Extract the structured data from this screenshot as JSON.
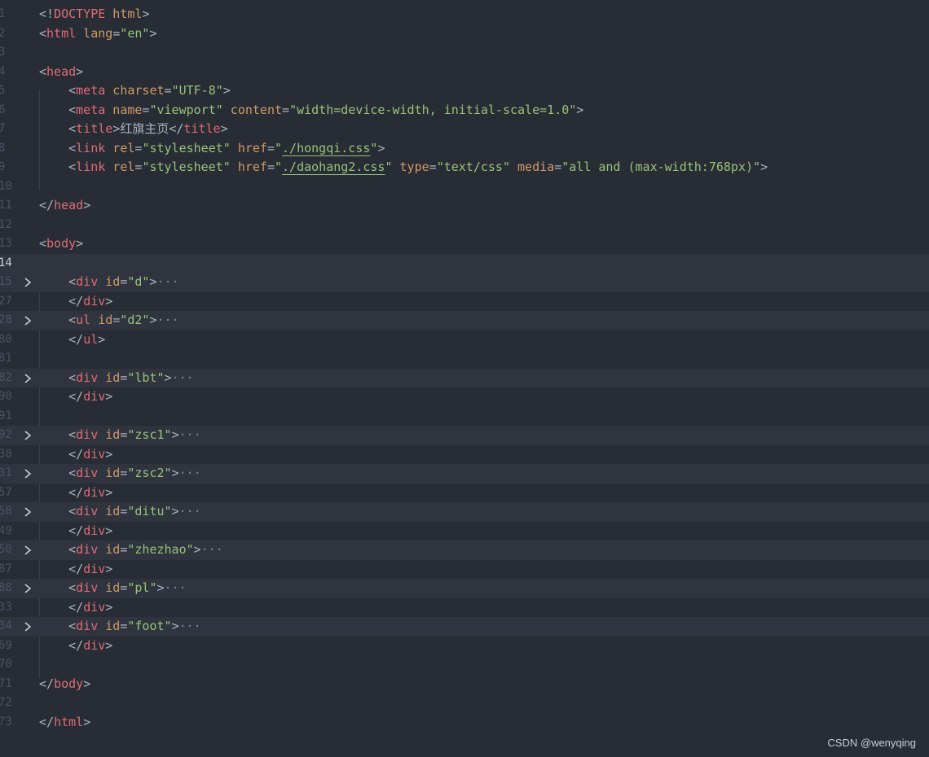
{
  "editor": {
    "lines": [
      {
        "num": "1",
        "tokens": [
          {
            "t": "<!",
            "c": "punc"
          },
          {
            "t": "DOCTYPE",
            "c": "tag"
          },
          {
            "t": " html",
            "c": "attr"
          },
          {
            "t": ">",
            "c": "punc"
          }
        ]
      },
      {
        "num": "2",
        "tokens": [
          {
            "t": "<",
            "c": "punc"
          },
          {
            "t": "html",
            "c": "tag"
          },
          {
            "t": " lang",
            "c": "attr"
          },
          {
            "t": "=",
            "c": "punc"
          },
          {
            "t": "\"en\"",
            "c": "str"
          },
          {
            "t": ">",
            "c": "punc"
          }
        ]
      },
      {
        "num": "3",
        "tokens": []
      },
      {
        "num": "4",
        "tokens": [
          {
            "t": "<",
            "c": "punc"
          },
          {
            "t": "head",
            "c": "tag"
          },
          {
            "t": ">",
            "c": "punc"
          }
        ]
      },
      {
        "num": "5",
        "tokens": [
          {
            "t": "    <",
            "c": "punc"
          },
          {
            "t": "meta",
            "c": "tag"
          },
          {
            "t": " charset",
            "c": "attr"
          },
          {
            "t": "=",
            "c": "punc"
          },
          {
            "t": "\"UTF-8\"",
            "c": "str"
          },
          {
            "t": ">",
            "c": "punc"
          }
        ]
      },
      {
        "num": "6",
        "tokens": [
          {
            "t": "    <",
            "c": "punc"
          },
          {
            "t": "meta",
            "c": "tag"
          },
          {
            "t": " name",
            "c": "attr"
          },
          {
            "t": "=",
            "c": "punc"
          },
          {
            "t": "\"viewport\"",
            "c": "str"
          },
          {
            "t": " content",
            "c": "attr"
          },
          {
            "t": "=",
            "c": "punc"
          },
          {
            "t": "\"width=device-width, initial-scale=1.0\"",
            "c": "str"
          },
          {
            "t": ">",
            "c": "punc"
          }
        ]
      },
      {
        "num": "7",
        "tokens": [
          {
            "t": "    <",
            "c": "punc"
          },
          {
            "t": "title",
            "c": "tag"
          },
          {
            "t": ">",
            "c": "punc"
          },
          {
            "t": "红旗主页",
            "c": "text"
          },
          {
            "t": "</",
            "c": "punc"
          },
          {
            "t": "title",
            "c": "tag"
          },
          {
            "t": ">",
            "c": "punc"
          }
        ]
      },
      {
        "num": "8",
        "tokens": [
          {
            "t": "    <",
            "c": "punc"
          },
          {
            "t": "link",
            "c": "tag"
          },
          {
            "t": " rel",
            "c": "attr"
          },
          {
            "t": "=",
            "c": "punc"
          },
          {
            "t": "\"stylesheet\"",
            "c": "str"
          },
          {
            "t": " href",
            "c": "attr"
          },
          {
            "t": "=",
            "c": "punc"
          },
          {
            "t": "\"",
            "c": "str"
          },
          {
            "t": "./hongqi.css",
            "c": "link"
          },
          {
            "t": "\"",
            "c": "str"
          },
          {
            "t": ">",
            "c": "punc"
          }
        ]
      },
      {
        "num": "9",
        "tokens": [
          {
            "t": "    <",
            "c": "punc"
          },
          {
            "t": "link",
            "c": "tag"
          },
          {
            "t": " rel",
            "c": "attr"
          },
          {
            "t": "=",
            "c": "punc"
          },
          {
            "t": "\"stylesheet\"",
            "c": "str"
          },
          {
            "t": " href",
            "c": "attr"
          },
          {
            "t": "=",
            "c": "punc"
          },
          {
            "t": "\"",
            "c": "str"
          },
          {
            "t": "./daohang2.css",
            "c": "link"
          },
          {
            "t": "\"",
            "c": "str"
          },
          {
            "t": " type",
            "c": "attr"
          },
          {
            "t": "=",
            "c": "punc"
          },
          {
            "t": "\"text/css\"",
            "c": "str"
          },
          {
            "t": " media",
            "c": "attr"
          },
          {
            "t": "=",
            "c": "punc"
          },
          {
            "t": "\"all and (max-width:768px)\"",
            "c": "str"
          },
          {
            "t": ">",
            "c": "punc"
          }
        ]
      },
      {
        "num": "10",
        "tokens": []
      },
      {
        "num": "11",
        "tokens": [
          {
            "t": "</",
            "c": "punc"
          },
          {
            "t": "head",
            "c": "tag"
          },
          {
            "t": ">",
            "c": "punc"
          }
        ]
      },
      {
        "num": "12",
        "tokens": []
      },
      {
        "num": "13",
        "tokens": [
          {
            "t": "<",
            "c": "punc"
          },
          {
            "t": "body",
            "c": "tag"
          },
          {
            "t": ">",
            "c": "punc"
          }
        ]
      },
      {
        "num": "14",
        "active": true,
        "highlight": true,
        "tokens": []
      },
      {
        "num": "15",
        "fold": true,
        "highlight": true,
        "tokens": [
          {
            "t": "    <",
            "c": "punc"
          },
          {
            "t": "div",
            "c": "tag"
          },
          {
            "t": " id",
            "c": "attr"
          },
          {
            "t": "=",
            "c": "punc"
          },
          {
            "t": "\"d\"",
            "c": "str"
          },
          {
            "t": ">",
            "c": "punc"
          },
          {
            "t": "···",
            "c": "dots"
          }
        ]
      },
      {
        "num": "27",
        "tokens": [
          {
            "t": "    </",
            "c": "punc"
          },
          {
            "t": "div",
            "c": "tag"
          },
          {
            "t": ">",
            "c": "punc"
          }
        ]
      },
      {
        "num": "28",
        "fold": true,
        "highlight": true,
        "tokens": [
          {
            "t": "    <",
            "c": "punc"
          },
          {
            "t": "ul",
            "c": "tag"
          },
          {
            "t": " id",
            "c": "attr"
          },
          {
            "t": "=",
            "c": "punc"
          },
          {
            "t": "\"d2\"",
            "c": "str"
          },
          {
            "t": ">",
            "c": "punc"
          },
          {
            "t": "···",
            "c": "dots"
          }
        ]
      },
      {
        "num": "80",
        "tokens": [
          {
            "t": "    </",
            "c": "punc"
          },
          {
            "t": "ul",
            "c": "tag"
          },
          {
            "t": ">",
            "c": "punc"
          }
        ]
      },
      {
        "num": "81",
        "tokens": []
      },
      {
        "num": "82",
        "fold": true,
        "highlight": true,
        "tokens": [
          {
            "t": "    <",
            "c": "punc"
          },
          {
            "t": "div",
            "c": "tag"
          },
          {
            "t": " id",
            "c": "attr"
          },
          {
            "t": "=",
            "c": "punc"
          },
          {
            "t": "\"lbt\"",
            "c": "str"
          },
          {
            "t": ">",
            "c": "punc"
          },
          {
            "t": "···",
            "c": "dots"
          }
        ]
      },
      {
        "num": "90",
        "tokens": [
          {
            "t": "    </",
            "c": "punc"
          },
          {
            "t": "div",
            "c": "tag"
          },
          {
            "t": ">",
            "c": "punc"
          }
        ]
      },
      {
        "num": "91",
        "tokens": []
      },
      {
        "num": "92",
        "fold": true,
        "highlight": true,
        "tokens": [
          {
            "t": "    <",
            "c": "punc"
          },
          {
            "t": "div",
            "c": "tag"
          },
          {
            "t": " id",
            "c": "attr"
          },
          {
            "t": "=",
            "c": "punc"
          },
          {
            "t": "\"zsc1\"",
            "c": "str"
          },
          {
            "t": ">",
            "c": "punc"
          },
          {
            "t": "···",
            "c": "dots"
          }
        ]
      },
      {
        "num": "30",
        "tokens": [
          {
            "t": "    </",
            "c": "punc"
          },
          {
            "t": "div",
            "c": "tag"
          },
          {
            "t": ">",
            "c": "punc"
          }
        ]
      },
      {
        "num": "31",
        "fold": true,
        "highlight": true,
        "tokens": [
          {
            "t": "    <",
            "c": "punc"
          },
          {
            "t": "div",
            "c": "tag"
          },
          {
            "t": " id",
            "c": "attr"
          },
          {
            "t": "=",
            "c": "punc"
          },
          {
            "t": "\"zsc2\"",
            "c": "str"
          },
          {
            "t": ">",
            "c": "punc"
          },
          {
            "t": "···",
            "c": "dots"
          }
        ]
      },
      {
        "num": "57",
        "tokens": [
          {
            "t": "    </",
            "c": "punc"
          },
          {
            "t": "div",
            "c": "tag"
          },
          {
            "t": ">",
            "c": "punc"
          }
        ]
      },
      {
        "num": "58",
        "fold": true,
        "highlight": true,
        "tokens": [
          {
            "t": "    <",
            "c": "punc"
          },
          {
            "t": "div",
            "c": "tag"
          },
          {
            "t": " id",
            "c": "attr"
          },
          {
            "t": "=",
            "c": "punc"
          },
          {
            "t": "\"ditu\"",
            "c": "str"
          },
          {
            "t": ">",
            "c": "punc"
          },
          {
            "t": "···",
            "c": "dots"
          }
        ]
      },
      {
        "num": "49",
        "tokens": [
          {
            "t": "    </",
            "c": "punc"
          },
          {
            "t": "div",
            "c": "tag"
          },
          {
            "t": ">",
            "c": "punc"
          }
        ]
      },
      {
        "num": "50",
        "fold": true,
        "highlight": true,
        "tokens": [
          {
            "t": "    <",
            "c": "punc"
          },
          {
            "t": "div",
            "c": "tag"
          },
          {
            "t": " id",
            "c": "attr"
          },
          {
            "t": "=",
            "c": "punc"
          },
          {
            "t": "\"zhezhao\"",
            "c": "str"
          },
          {
            "t": ">",
            "c": "punc"
          },
          {
            "t": "···",
            "c": "dots"
          }
        ]
      },
      {
        "num": "87",
        "tokens": [
          {
            "t": "    </",
            "c": "punc"
          },
          {
            "t": "div",
            "c": "tag"
          },
          {
            "t": ">",
            "c": "punc"
          }
        ]
      },
      {
        "num": "88",
        "fold": true,
        "highlight": true,
        "tokens": [
          {
            "t": "    <",
            "c": "punc"
          },
          {
            "t": "div",
            "c": "tag"
          },
          {
            "t": " id",
            "c": "attr"
          },
          {
            "t": "=",
            "c": "punc"
          },
          {
            "t": "\"pl\"",
            "c": "str"
          },
          {
            "t": ">",
            "c": "punc"
          },
          {
            "t": "···",
            "c": "dots"
          }
        ]
      },
      {
        "num": "33",
        "tokens": [
          {
            "t": "    </",
            "c": "punc"
          },
          {
            "t": "div",
            "c": "tag"
          },
          {
            "t": ">",
            "c": "punc"
          }
        ]
      },
      {
        "num": "34",
        "fold": true,
        "highlight": true,
        "tokens": [
          {
            "t": "    <",
            "c": "punc"
          },
          {
            "t": "div",
            "c": "tag"
          },
          {
            "t": " id",
            "c": "attr"
          },
          {
            "t": "=",
            "c": "punc"
          },
          {
            "t": "\"foot\"",
            "c": "str"
          },
          {
            "t": ">",
            "c": "punc"
          },
          {
            "t": "···",
            "c": "dots"
          }
        ]
      },
      {
        "num": "69",
        "tokens": [
          {
            "t": "    </",
            "c": "punc"
          },
          {
            "t": "div",
            "c": "tag"
          },
          {
            "t": ">",
            "c": "punc"
          }
        ]
      },
      {
        "num": "70",
        "tokens": []
      },
      {
        "num": "71",
        "tokens": [
          {
            "t": "</",
            "c": "punc"
          },
          {
            "t": "body",
            "c": "tag"
          },
          {
            "t": ">",
            "c": "punc"
          }
        ]
      },
      {
        "num": "72",
        "tokens": []
      },
      {
        "num": "73",
        "tokens": [
          {
            "t": "</",
            "c": "punc"
          },
          {
            "t": "html",
            "c": "tag"
          },
          {
            "t": ">",
            "c": "punc"
          }
        ]
      }
    ],
    "fold_icon": "chevron-right-icon"
  },
  "watermark": "CSDN @wenyqing",
  "colors": {
    "background": "#282c34",
    "line_highlight": "#2f343e",
    "tag": "#e06c75",
    "attribute": "#d19a66",
    "string": "#98c379",
    "punctuation": "#abb2bf",
    "gutter": "#4b5263"
  }
}
